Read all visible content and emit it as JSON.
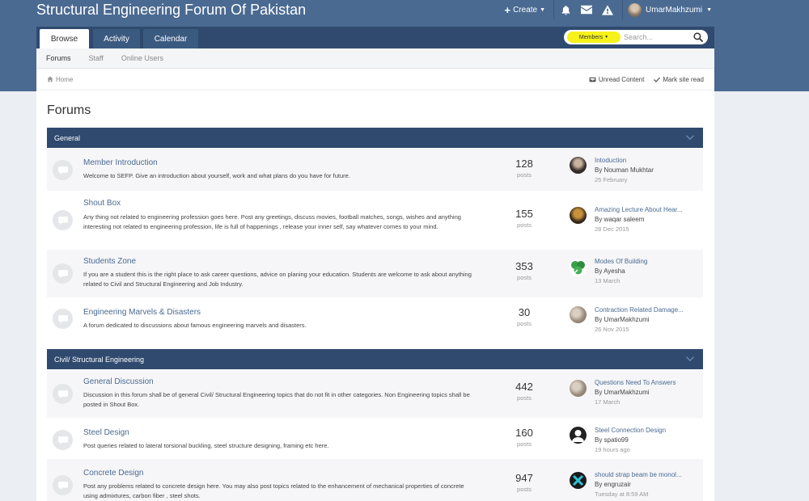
{
  "header": {
    "site_title": "Structural Engineering Forum Of Pakistan",
    "create_label": "Create",
    "username": "UmarMakhzumi"
  },
  "nav": {
    "tabs": [
      {
        "label": "Browse",
        "active": true
      },
      {
        "label": "Activity",
        "active": false
      },
      {
        "label": "Calendar",
        "active": false
      }
    ],
    "members_label": "Members",
    "search_placeholder": "Search..."
  },
  "subnav": {
    "items": [
      "Forums",
      "Staff",
      "Online Users"
    ]
  },
  "breadcrumb": {
    "home": "Home",
    "unread": "Unread Content",
    "mark_read": "Mark site read"
  },
  "page_title": "Forums",
  "categories": [
    {
      "title": "General",
      "forums": [
        {
          "name": "Member Introduction",
          "desc": "Welcome to SEFP. Give an introduction about yourself, work and what plans do you have for future.",
          "count": "128",
          "count_label": "posts",
          "last_title": "Intoduction",
          "last_by": "By Nouman Mukhtar",
          "last_time": "25 February"
        },
        {
          "name": "Shout Box",
          "desc": "Any thing not related to engineering profession goes here. Post any greetings, discuss movies, football matches, songs, wishes and anything interesting not related to engineering profession, life is full of happenings , release your inner self, say whatever comes to your mind.",
          "count": "155",
          "count_label": "posts",
          "last_title": "Amazing Lecture About Hear...",
          "last_by": "By waqar saleem",
          "last_time": "28 Dec 2015"
        },
        {
          "name": "Students Zone",
          "desc": "If you are a student this is the right place to ask career questions, advice on planing your education. Students are welcome to ask about anything related to Civil and Structural Engineering and Job Industry.",
          "count": "353",
          "count_label": "posts",
          "last_title": "Modes Of Building",
          "last_by": "By Ayesha",
          "last_time": "13 March"
        },
        {
          "name": "Engineering Marvels & Disasters",
          "desc": "A forum dedicated to discussions about famous engineering marvels and disasters.",
          "count": "30",
          "count_label": "posts",
          "last_title": "Contraction Related Damage...",
          "last_by": "By UmarMakhzumi",
          "last_time": "26 Nov 2015"
        }
      ]
    },
    {
      "title": "Civil/ Structural Engineering",
      "forums": [
        {
          "name": "General Discussion",
          "desc": "Discussion in this forum shall be of general Civil/ Structural Engineering topics that do not fit in other categories. Non Engineering topics shall be posted in Shout Box.",
          "count": "442",
          "count_label": "posts",
          "last_title": "Questions Need To Answers",
          "last_by": "By UmarMakhzumi",
          "last_time": "17 March"
        },
        {
          "name": "Steel Design",
          "desc": "Post queries related to lateral torsional buckling, steel structure designing, framing etc here.",
          "count": "160",
          "count_label": "posts",
          "last_title": "Steel Connection Design",
          "last_by": "By spatio99",
          "last_time": "19 hours ago"
        },
        {
          "name": "Concrete Design",
          "desc": "Post any problems related to concrete design here. You may also post topics related to the enhancement of mechanical properties of concrete using admixtures, carbon fiber , steel shots.",
          "count": "947",
          "count_label": "posts",
          "last_title": "should strap beam be monol...",
          "last_by": "By engruzair",
          "last_time": "Tuesday at 8:59 AM"
        }
      ]
    }
  ],
  "colors": {
    "header_bg": "#4a6a91",
    "nav_bg": "#2f4a6e",
    "link": "#4a6a91",
    "members_highlight": "#f6f21a"
  }
}
